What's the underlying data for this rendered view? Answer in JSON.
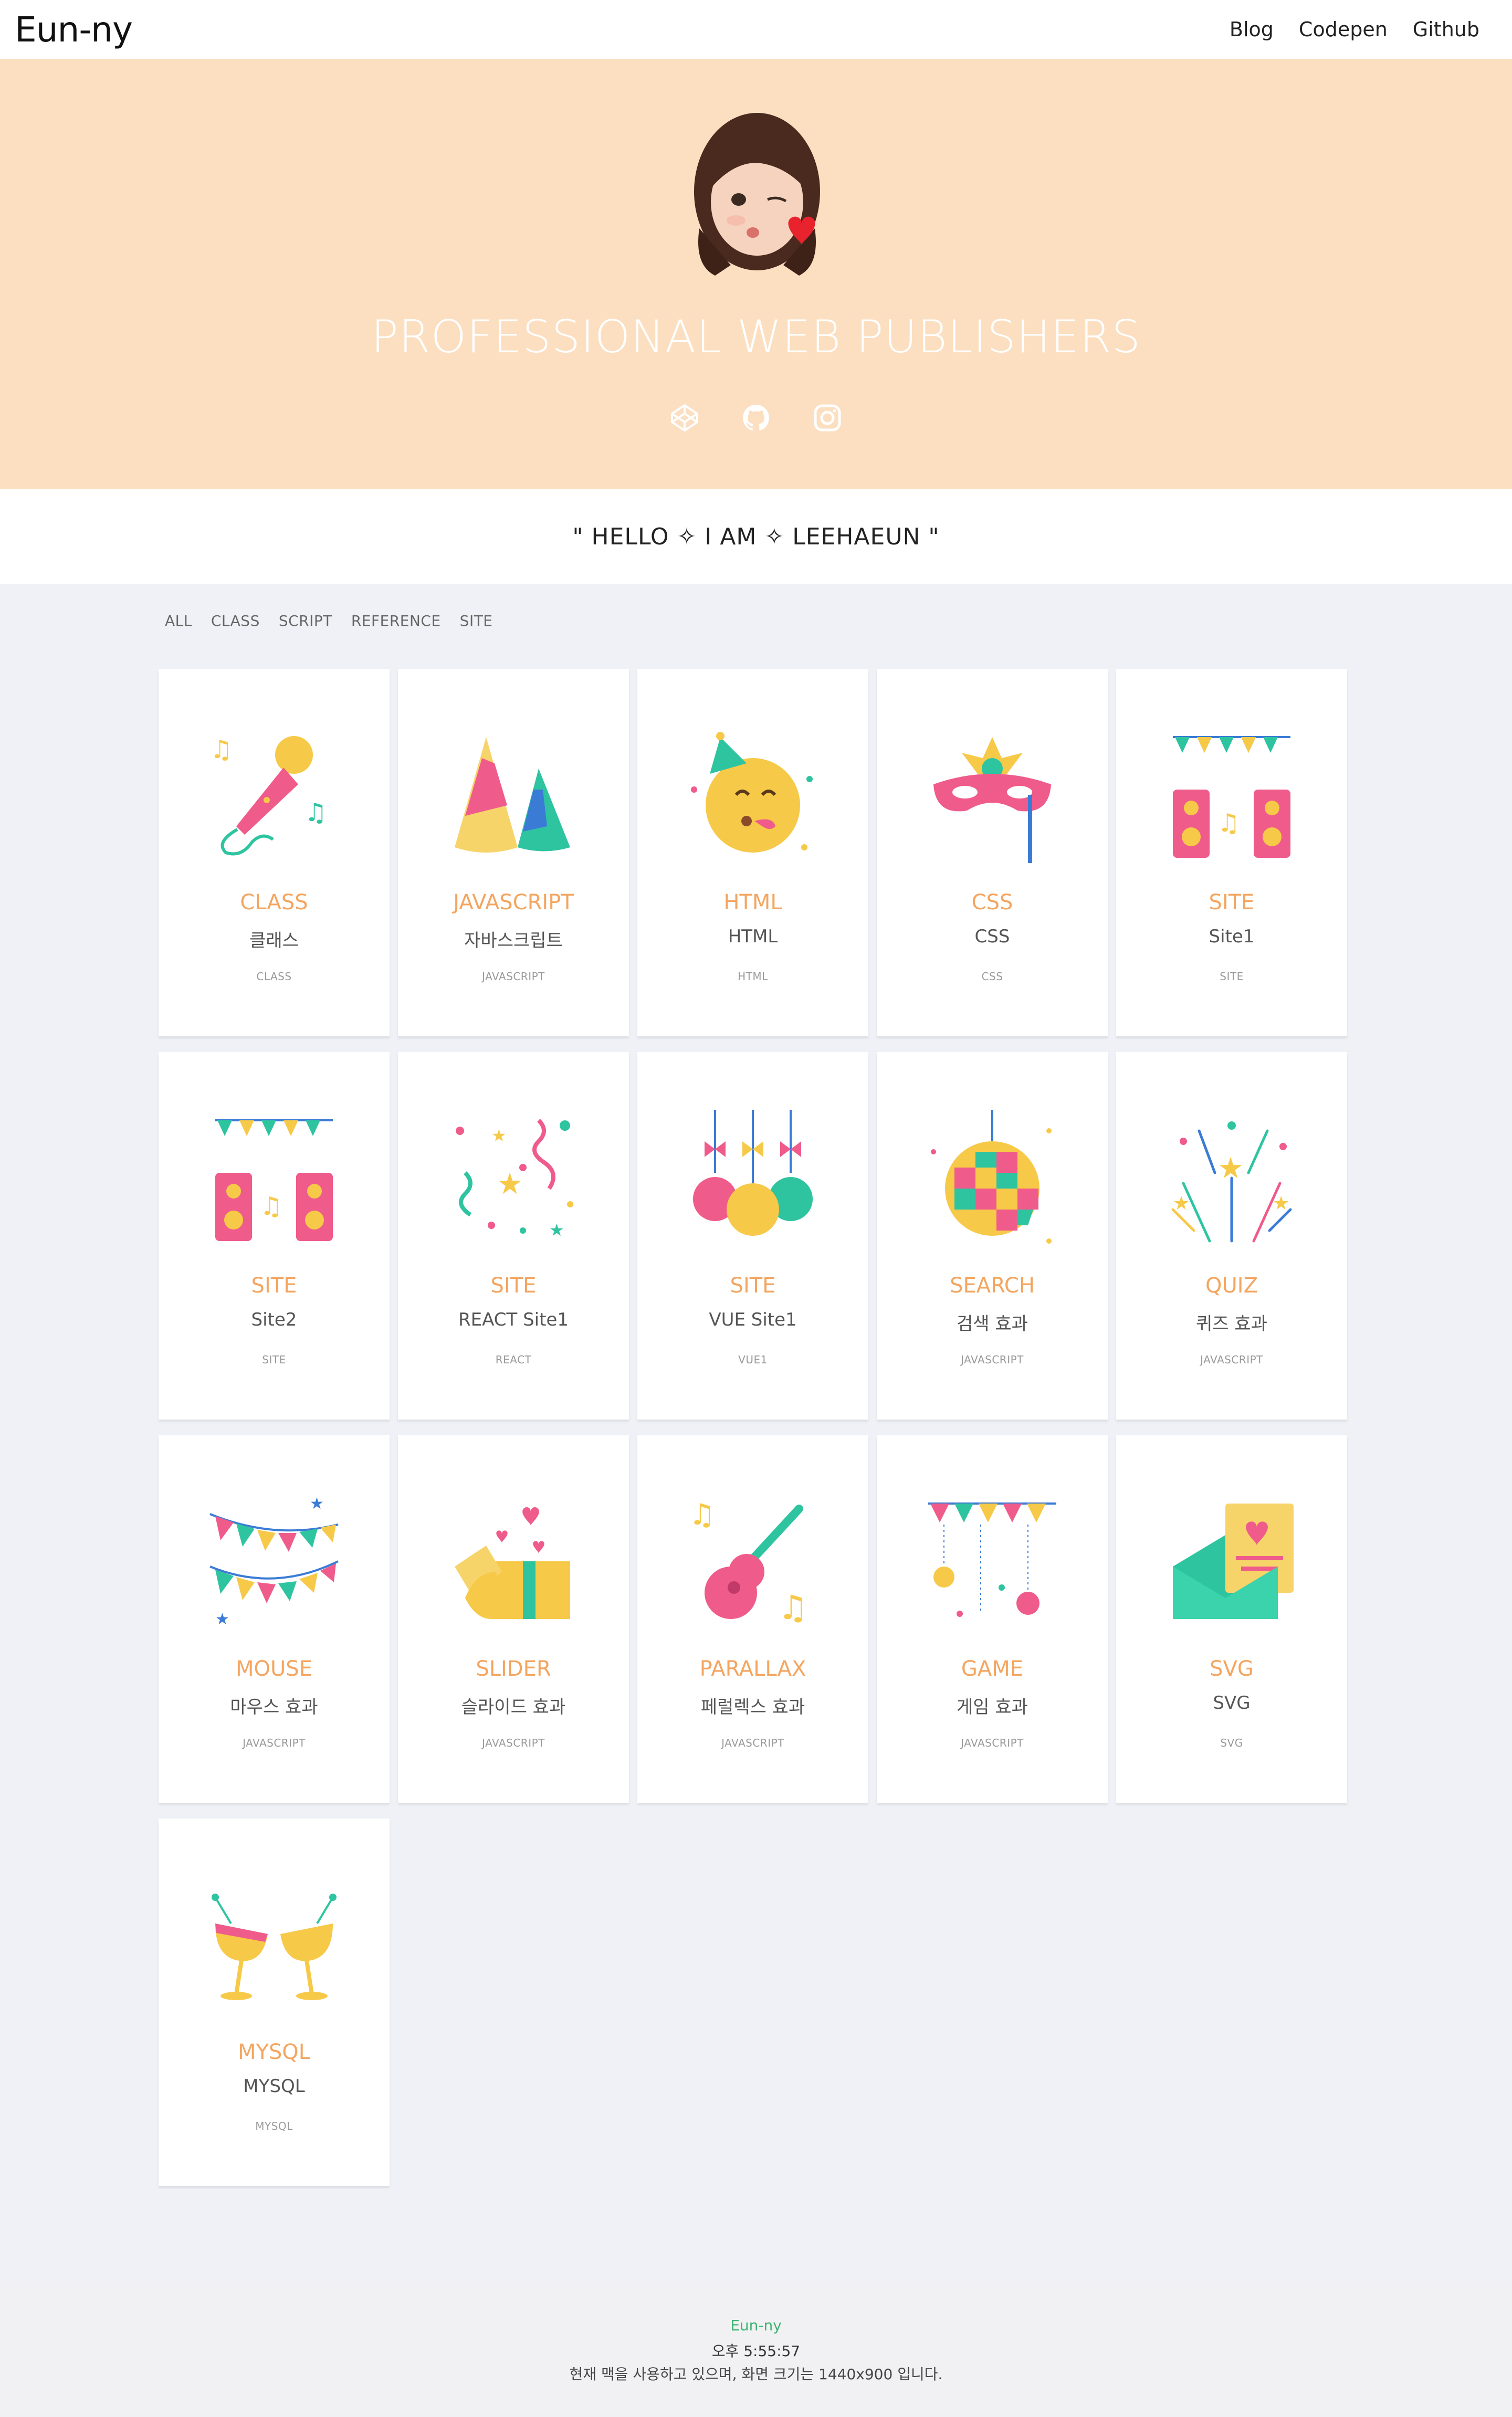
{
  "header": {
    "logo": "Eun-ny",
    "nav": [
      "Blog",
      "Codepen",
      "Github"
    ]
  },
  "hero": {
    "title": "PROFESSIONAL WEB PUBLISHERS",
    "social_icons": [
      "codepen-icon",
      "github-icon",
      "instagram-icon"
    ]
  },
  "intro": "\" HELLO ✧ I AM ✧ LEEHAEUN \"",
  "filters": [
    "ALL",
    "CLASS",
    "SCRIPT",
    "REFERENCE",
    "SITE"
  ],
  "cards": [
    {
      "title": "CLASS",
      "subtitle": "클래스",
      "tag": "CLASS",
      "icon": "microphone-icon"
    },
    {
      "title": "JAVASCRIPT",
      "subtitle": "자바스크립트",
      "tag": "JAVASCRIPT",
      "icon": "party-hats-icon"
    },
    {
      "title": "HTML",
      "subtitle": "HTML",
      "tag": "HTML",
      "icon": "party-face-icon"
    },
    {
      "title": "CSS",
      "subtitle": "CSS",
      "tag": "CSS",
      "icon": "masquerade-mask-icon"
    },
    {
      "title": "SITE",
      "subtitle": "Site1",
      "tag": "SITE",
      "icon": "speakers-icon"
    },
    {
      "title": "SITE",
      "subtitle": "Site2",
      "tag": "SITE",
      "icon": "speakers-icon"
    },
    {
      "title": "SITE",
      "subtitle": "REACT Site1",
      "tag": "REACT",
      "icon": "confetti-icon"
    },
    {
      "title": "SITE",
      "subtitle": "VUE Site1",
      "tag": "VUE1",
      "icon": "ornaments-icon"
    },
    {
      "title": "SEARCH",
      "subtitle": "검색 효과",
      "tag": "JAVASCRIPT",
      "icon": "disco-ball-icon"
    },
    {
      "title": "QUIZ",
      "subtitle": "퀴즈 효과",
      "tag": "JAVASCRIPT",
      "icon": "fireworks-icon"
    },
    {
      "title": "MOUSE",
      "subtitle": "마우스 효과",
      "tag": "JAVASCRIPT",
      "icon": "bunting-flags-icon"
    },
    {
      "title": "SLIDER",
      "subtitle": "슬라이드 효과",
      "tag": "JAVASCRIPT",
      "icon": "gift-box-icon"
    },
    {
      "title": "PARALLAX",
      "subtitle": "페럴렉스 효과",
      "tag": "JAVASCRIPT",
      "icon": "guitar-icon"
    },
    {
      "title": "GAME",
      "subtitle": "게임 효과",
      "tag": "JAVASCRIPT",
      "icon": "garland-icon"
    },
    {
      "title": "SVG",
      "subtitle": "SVG",
      "tag": "SVG",
      "icon": "envelope-card-icon"
    },
    {
      "title": "MYSQL",
      "subtitle": "MYSQL",
      "tag": "MYSQL",
      "icon": "cheers-glasses-icon"
    }
  ],
  "footer": {
    "name": "Eun-ny",
    "time": "오후 5:55:57",
    "message": "현재 맥을 사용하고 있으며, 화면 크기는 1440x900 입니다."
  },
  "colors": {
    "hero_bg": "#fbdfc0",
    "card_title": "#f4a55f",
    "footer_accent": "#3cb371"
  }
}
